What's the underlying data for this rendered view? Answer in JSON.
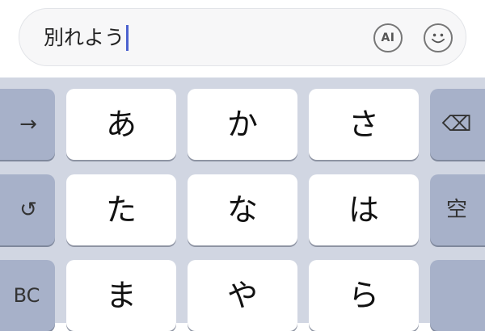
{
  "input": {
    "text": "別れよう",
    "ai_button_label": "AI",
    "emoji_icon": "smiley-face-icon"
  },
  "keyboard": {
    "rows": [
      {
        "left_func": "→",
        "keys": [
          "あ",
          "か",
          "さ"
        ],
        "right_func": "⌫"
      },
      {
        "left_func": "↺",
        "keys": [
          "た",
          "な",
          "は"
        ],
        "right_func": "空"
      },
      {
        "left_func": "BC",
        "keys": [
          "ま",
          "や",
          "ら"
        ],
        "right_func": ""
      }
    ]
  },
  "colors": {
    "keyboard_bg": "#d1d6e2",
    "char_key": "#ffffff",
    "func_key": "#a7b1c9",
    "caret": "#4c62cf"
  }
}
